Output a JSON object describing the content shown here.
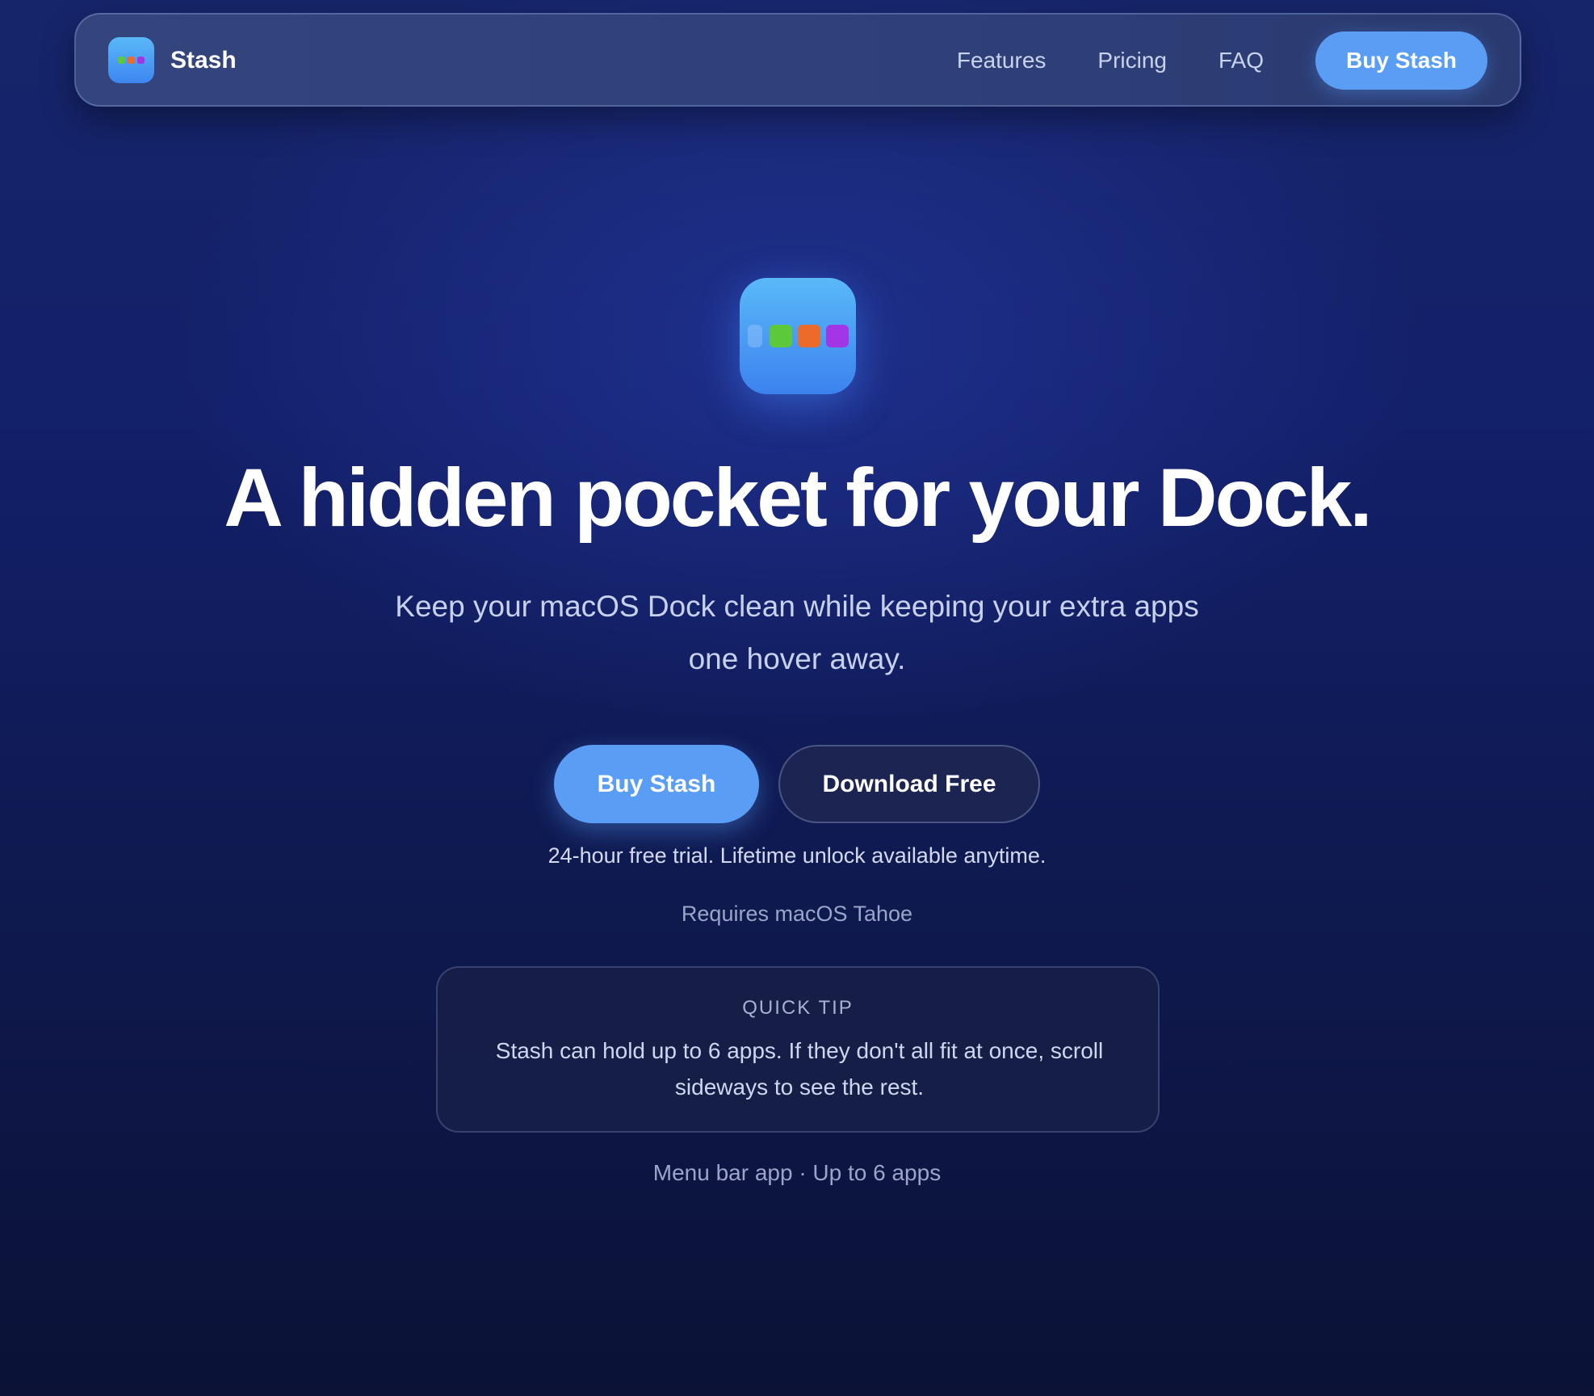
{
  "nav": {
    "brand": "Stash",
    "links": [
      "Features",
      "Pricing",
      "FAQ"
    ],
    "buy_label": "Buy Stash"
  },
  "icon_colors": {
    "green": "#5cc93a",
    "orange": "#ec6a2a",
    "purple": "#a235e6",
    "accent": "#5a9df5"
  },
  "hero": {
    "headline": "A hidden pocket for your Dock.",
    "subline": "Keep your macOS Dock clean while keeping your extra apps one hover away.",
    "primary_cta": "Buy Stash",
    "secondary_cta": "Download Free",
    "trial_note": "24-hour free trial. Lifetime unlock available anytime.",
    "requires": "Requires macOS Tahoe"
  },
  "tip": {
    "label": "QUICK TIP",
    "text": "Stash can hold up to 6 apps. If they don't all fit at once, scroll sideways to see the rest."
  },
  "footer_note": "Menu bar app · Up to 6 apps"
}
